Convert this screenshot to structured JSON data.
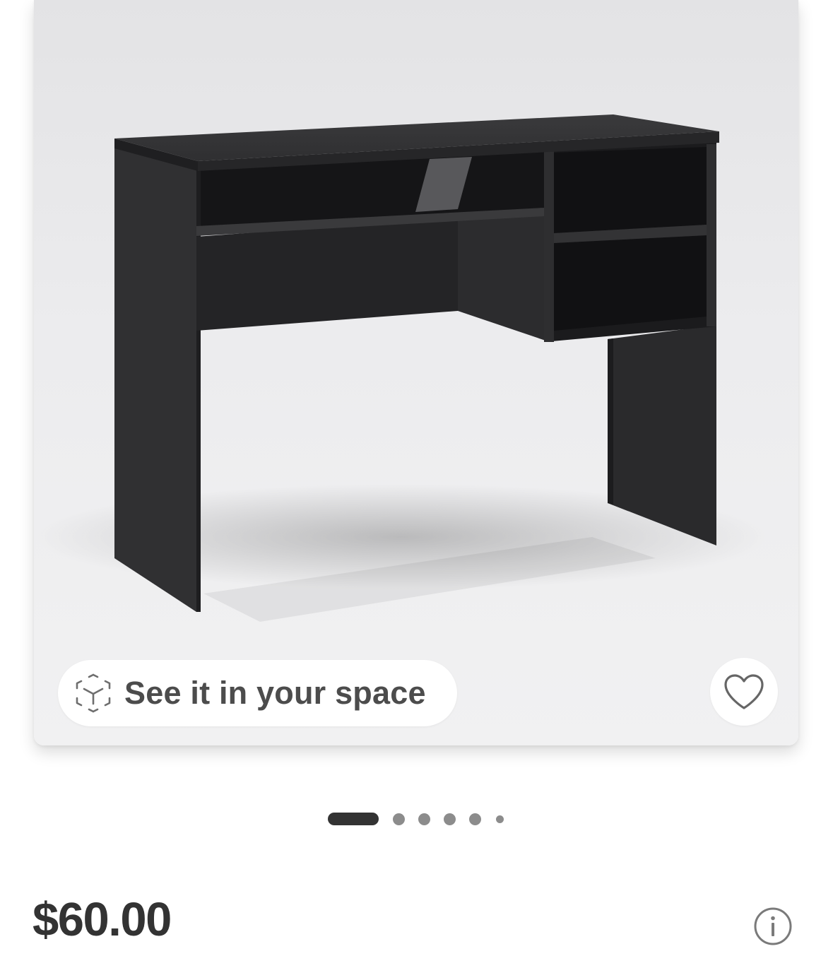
{
  "product": {
    "image_icon": "desk-photo",
    "ar_button": {
      "label": "See it in your space",
      "icon": "ar-cube-icon"
    },
    "favorite_icon": "heart-outline-icon"
  },
  "gallery": {
    "total_images": 6,
    "current_index": 1
  },
  "price": {
    "value": "$60.00"
  },
  "info_icon": "info-circle-icon",
  "colors": {
    "price_text": "#333333",
    "ar_label": "#4c4c4c",
    "desk": "#2b2b2d",
    "pager_active": "#333333",
    "pager_inactive": "#8c8c8c"
  }
}
